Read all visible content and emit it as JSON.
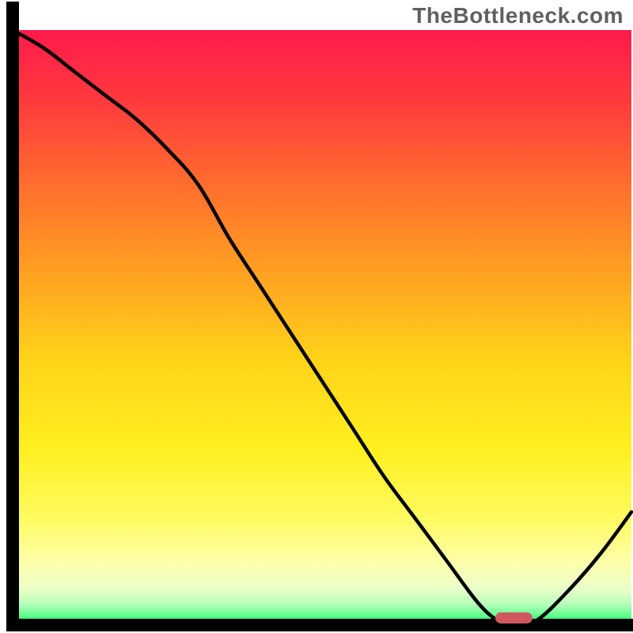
{
  "watermark": "TheBottleneck.com",
  "chart_data": {
    "type": "line",
    "title": "",
    "xlabel": "",
    "ylabel": "",
    "xlim": [
      0,
      100
    ],
    "ylim": [
      0,
      100
    ],
    "x": [
      0,
      5,
      10,
      15,
      20,
      25,
      30,
      35,
      40,
      45,
      50,
      55,
      60,
      65,
      70,
      75,
      78,
      80,
      82,
      85,
      90,
      95,
      100
    ],
    "values": [
      100,
      97,
      93,
      89,
      85,
      80,
      74,
      65,
      57,
      49,
      41,
      33,
      25,
      18,
      11,
      4,
      1,
      0,
      0,
      1,
      6,
      12,
      19
    ],
    "marker": {
      "x_start": 78,
      "x_end": 84,
      "y": 1.2
    },
    "_note": "x and values are percentages read off the plot by eye; the solid marker sits at roughly 78–84% along x, just above the baseline."
  },
  "gradient_stops": [
    {
      "offset": 0.0,
      "color": "#ff1a4b"
    },
    {
      "offset": 0.12,
      "color": "#ff3a3e"
    },
    {
      "offset": 0.25,
      "color": "#ff6a2e"
    },
    {
      "offset": 0.4,
      "color": "#ff9e22"
    },
    {
      "offset": 0.55,
      "color": "#ffd21a"
    },
    {
      "offset": 0.7,
      "color": "#ffef1e"
    },
    {
      "offset": 0.82,
      "color": "#fffb60"
    },
    {
      "offset": 0.9,
      "color": "#fdffb0"
    },
    {
      "offset": 0.94,
      "color": "#e9ffc9"
    },
    {
      "offset": 0.965,
      "color": "#b6ffba"
    },
    {
      "offset": 0.985,
      "color": "#5cff8a"
    },
    {
      "offset": 1.0,
      "color": "#00e765"
    }
  ],
  "marker_color": "#d0575f",
  "curve_color": "#000000",
  "axis_color": "#000000"
}
